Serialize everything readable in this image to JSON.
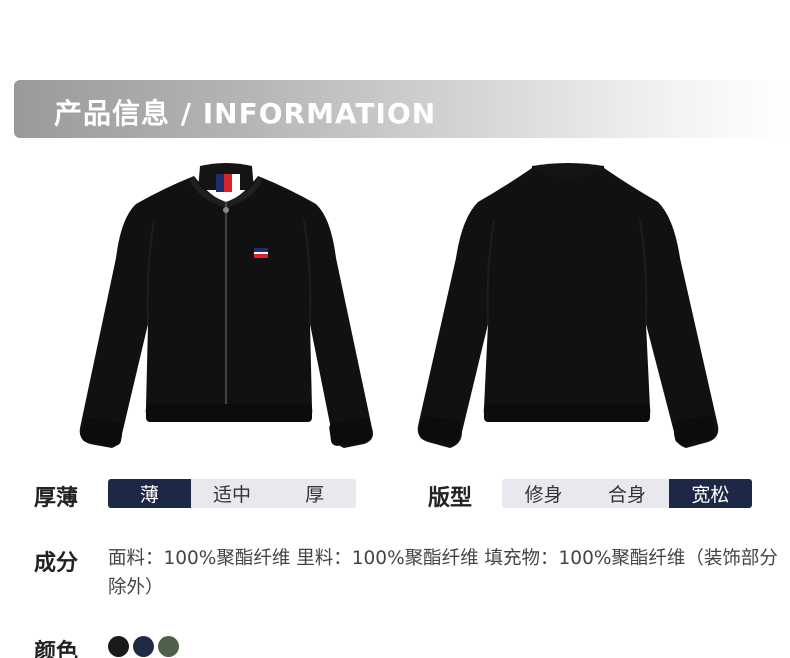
{
  "banner": {
    "title": "产品信息 / INFORMATION"
  },
  "images": [
    {
      "name": "jacket-front",
      "alt": ""
    },
    {
      "name": "jacket-back",
      "alt": ""
    }
  ],
  "thickness": {
    "label": "厚薄",
    "options": [
      "薄",
      "适中",
      "厚"
    ],
    "selected": "薄"
  },
  "fit": {
    "label": "版型",
    "options": [
      "修身",
      "合身",
      "宽松"
    ],
    "selected": "宽松"
  },
  "composition": {
    "label": "成分",
    "text": "面料：100%聚酯纤维 里料：100%聚酯纤维 填充物：100%聚酯纤维（装饰部分除外）"
  },
  "colors": {
    "label": "颜色",
    "swatches": [
      "#1a1a1a",
      "#1f2a44",
      "#4f5f48"
    ]
  }
}
